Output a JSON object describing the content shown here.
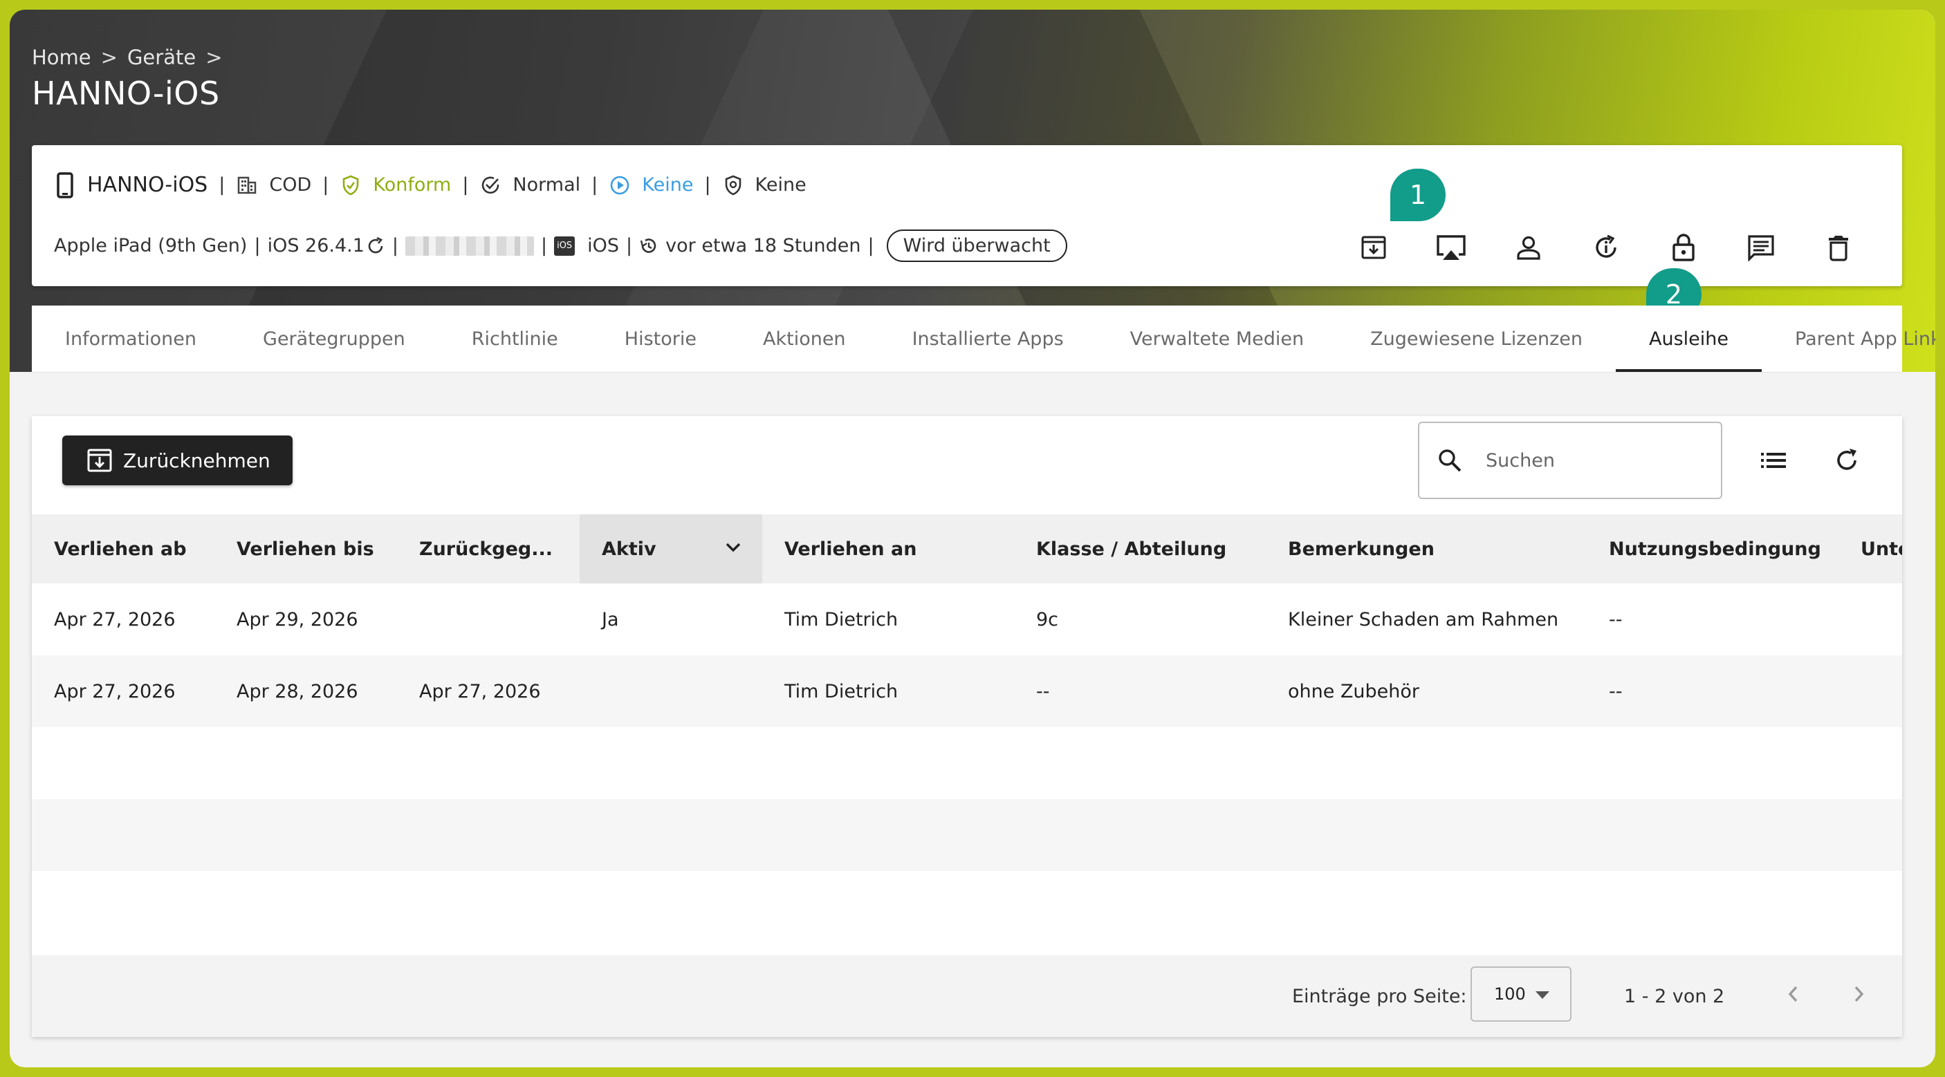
{
  "breadcrumb": {
    "items": [
      "Home",
      "Geräte"
    ],
    "separator": ">"
  },
  "page_title": "HANNO-iOS",
  "device": {
    "name": "HANNO-iOS",
    "ownership": "COD",
    "compliance": "Konform",
    "mode": "Normal",
    "lost_mode": "Keine",
    "security": "Keine",
    "model": "Apple iPad (9th Gen)",
    "os_version": "iOS 26.4.1",
    "platform": "iOS",
    "platform_badge": "iOS",
    "last_seen": "vor etwa 18 Stunden",
    "supervised_label": "Wird überwacht"
  },
  "colors": {
    "compliance": "#8fae12",
    "lost_mode": "#3a9de0",
    "marker": "#129c8a",
    "accent_bg": "#b8c91a"
  },
  "action_icons": [
    "return-device-icon",
    "airplay-icon",
    "user-icon",
    "restart-icon",
    "lock-icon",
    "message-icon",
    "delete-icon"
  ],
  "markers": [
    "1",
    "2"
  ],
  "tabs": [
    {
      "label": "Informationen",
      "active": false
    },
    {
      "label": "Gerätegruppen",
      "active": false
    },
    {
      "label": "Richtlinie",
      "active": false
    },
    {
      "label": "Historie",
      "active": false
    },
    {
      "label": "Aktionen",
      "active": false
    },
    {
      "label": "Installierte Apps",
      "active": false
    },
    {
      "label": "Verwaltete Medien",
      "active": false
    },
    {
      "label": "Zugewiesene Lizenzen",
      "active": false
    },
    {
      "label": "Ausleihe",
      "active": true
    },
    {
      "label": "Parent App Links",
      "active": false
    }
  ],
  "toolbar": {
    "return_label": "Zurücknehmen",
    "search_placeholder": "Suchen"
  },
  "table": {
    "columns": [
      "Verliehen ab",
      "Verliehen bis",
      "Zurückgeg...",
      "Aktiv",
      "Verliehen an",
      "Klasse / Abteilung",
      "Bemerkungen",
      "Nutzungsbedingung",
      "Unte"
    ],
    "sorted_column": "Aktiv",
    "rows": [
      [
        "Apr 27, 2026",
        "Apr 29, 2026",
        "",
        "Ja",
        "Tim Dietrich",
        "9c",
        "Kleiner Schaden am Rahmen",
        "--",
        ""
      ],
      [
        "Apr 27, 2026",
        "Apr 28, 2026",
        "Apr 27, 2026",
        "",
        "Tim Dietrich",
        "--",
        "ohne Zubehör",
        "--",
        ""
      ]
    ]
  },
  "pagination": {
    "per_page_label": "Einträge pro Seite:",
    "per_page_value": "100",
    "range": "1 - 2 von 2"
  }
}
